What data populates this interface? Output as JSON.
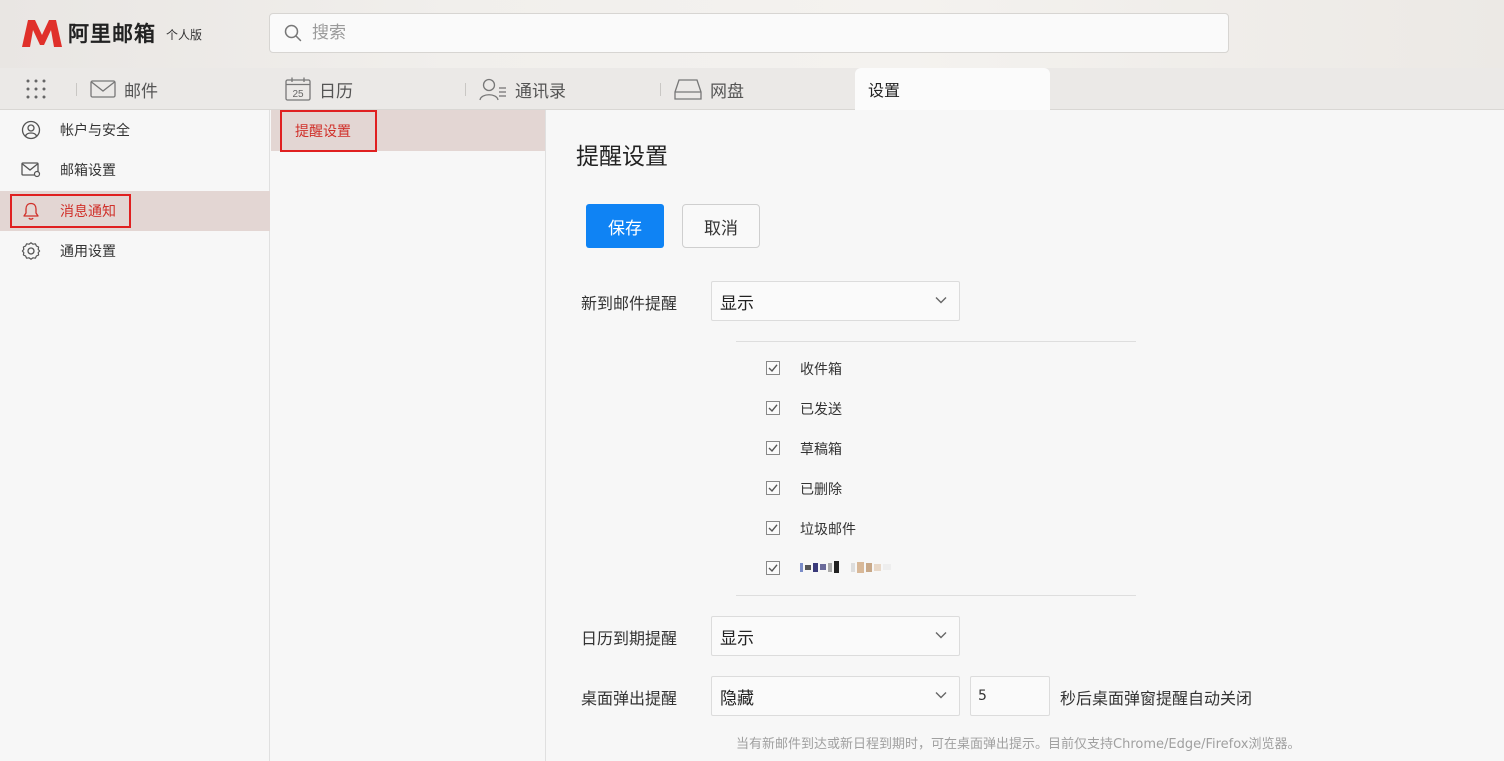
{
  "header": {
    "logo_text": "阿里邮箱",
    "edition": "个人版",
    "search_placeholder": "搜索"
  },
  "tabs": [
    {
      "label": "邮件"
    },
    {
      "label": "日历",
      "icon_text": "25"
    },
    {
      "label": "通讯录"
    },
    {
      "label": "网盘"
    },
    {
      "label": "设置"
    }
  ],
  "sidebar": {
    "items": [
      {
        "label": "帐户与安全"
      },
      {
        "label": "邮箱设置"
      },
      {
        "label": "消息通知"
      },
      {
        "label": "通用设置"
      }
    ]
  },
  "submenu": {
    "items": [
      {
        "label": "提醒设置"
      }
    ]
  },
  "main": {
    "title": "提醒设置",
    "save_label": "保存",
    "cancel_label": "取消",
    "new_mail": {
      "label": "新到邮件提醒",
      "value": "显示",
      "folders": [
        "收件箱",
        "已发送",
        "草稿箱",
        "已删除",
        "垃圾邮件"
      ]
    },
    "calendar": {
      "label": "日历到期提醒",
      "value": "显示"
    },
    "desktop": {
      "label": "桌面弹出提醒",
      "value": "隐藏",
      "seconds": "5",
      "after_text": "秒后桌面弹窗提醒自动关闭",
      "hint": "当有新邮件到达或新日程到期时，可在桌面弹出提示。目前仅支持Chrome/Edge/Firefox浏览器。"
    }
  },
  "colors": {
    "brand_red": "#e0302a",
    "primary_blue": "#0f83f4",
    "active_bg": "#e3d6d3",
    "highlight_border": "#e02020"
  }
}
